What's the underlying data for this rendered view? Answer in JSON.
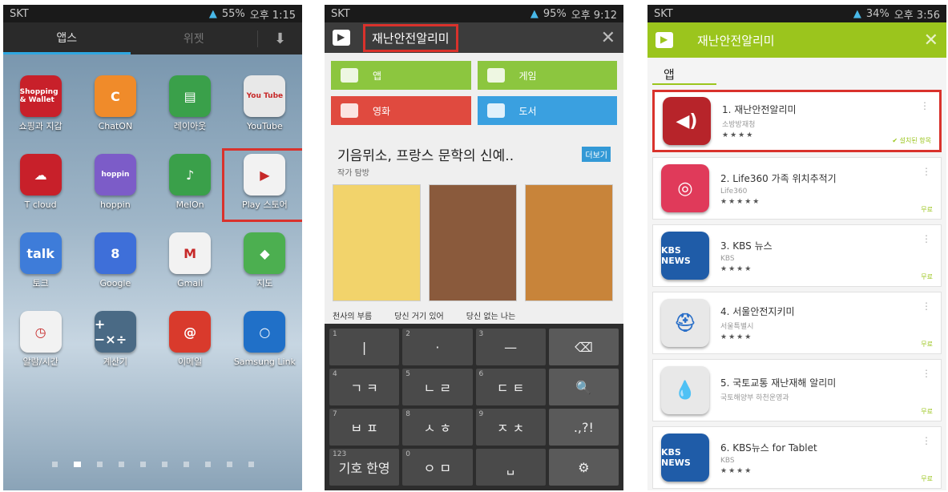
{
  "phone1": {
    "status": {
      "carrier": "SKT",
      "battery": "55%",
      "time": "오후 1:15"
    },
    "tabs": {
      "apps": "앱스",
      "widgets": "위젯",
      "download": "⬇"
    },
    "apps": [
      {
        "label": "쇼핑과 지갑",
        "icon_text": "Shopping & Wallet",
        "color": "#c8202a"
      },
      {
        "label": "ChatON",
        "icon_text": "C",
        "color": "#f08b2a"
      },
      {
        "label": "레이아웃",
        "icon_text": "▤",
        "color": "#3aa04a"
      },
      {
        "label": "YouTube",
        "icon_text": "You Tube",
        "color": "#e8e8e8"
      },
      {
        "label": "T cloud",
        "icon_text": "☁",
        "color": "#c8202a"
      },
      {
        "label": "hoppin",
        "icon_text": "hoppin",
        "color": "#7c5cc8"
      },
      {
        "label": "MelOn",
        "icon_text": "♪",
        "color": "#3aa04a"
      },
      {
        "label": "Play 스토어",
        "icon_text": "▶",
        "color": "#f2f2f2"
      },
      {
        "label": "토크",
        "icon_text": "talk",
        "color": "#3e7cd9"
      },
      {
        "label": "Google",
        "icon_text": "8",
        "color": "#3e6fd9"
      },
      {
        "label": "Gmail",
        "icon_text": "M",
        "color": "#f2f2f2"
      },
      {
        "label": "지도",
        "icon_text": "◆",
        "color": "#4caf50"
      },
      {
        "label": "알람/시간",
        "icon_text": "◷",
        "color": "#f2f2f2"
      },
      {
        "label": "계산기",
        "icon_text": "+−×÷",
        "color": "#4a6a85"
      },
      {
        "label": "이메일",
        "icon_text": "@",
        "color": "#d93a2c"
      },
      {
        "label": "Samsung Link",
        "icon_text": "○",
        "color": "#2070c8"
      }
    ]
  },
  "phone2": {
    "status": {
      "carrier": "SKT",
      "battery": "95%",
      "time": "오후 9:12"
    },
    "search": {
      "query": "재난안전알리미",
      "close": "✕"
    },
    "categories": [
      {
        "label": "앱",
        "color": "#8cc63f"
      },
      {
        "label": "게임",
        "color": "#8cc63f"
      },
      {
        "label": "영화",
        "color": "#e04a3f"
      },
      {
        "label": "도서",
        "color": "#3aa0e0"
      }
    ],
    "section": {
      "title": "기음뮈소, 프랑스 문학의 신예..",
      "subtitle": "작가 탐방",
      "more": "더보기"
    },
    "books": [
      {
        "title": "천사의 부름",
        "color": "#f2d36b"
      },
      {
        "title": "당신 거기 있어",
        "color": "#8a5a3c"
      },
      {
        "title": "당신 없는 나는",
        "color": "#c8843a"
      }
    ],
    "keyboard": [
      {
        "num": "1",
        "chars": "|"
      },
      {
        "num": "2",
        "chars": "·"
      },
      {
        "num": "3",
        "chars": "—"
      },
      {
        "num": "",
        "chars": "⌫"
      },
      {
        "num": "4",
        "chars": "ㄱ ㅋ"
      },
      {
        "num": "5",
        "chars": "ㄴ ㄹ"
      },
      {
        "num": "6",
        "chars": "ㄷ ㅌ"
      },
      {
        "num": "",
        "chars": "🔍"
      },
      {
        "num": "7",
        "chars": "ㅂ ㅍ"
      },
      {
        "num": "8",
        "chars": "ㅅ ㅎ"
      },
      {
        "num": "9",
        "chars": "ㅈ ㅊ"
      },
      {
        "num": "",
        "chars": ".,?!"
      },
      {
        "num": "123",
        "chars": "기호 한영"
      },
      {
        "num": "0",
        "chars": "ㅇ ㅁ"
      },
      {
        "num": "",
        "chars": "␣"
      },
      {
        "num": "",
        "chars": "⚙"
      }
    ]
  },
  "phone3": {
    "status": {
      "carrier": "SKT",
      "battery": "34%",
      "time": "오후 3:56"
    },
    "search": {
      "query": "재난안전알리미",
      "close": "✕"
    },
    "section": "앱",
    "results": [
      {
        "name": "1. 재난안전알리미",
        "dev": "소방방재청",
        "stars": "★★★★",
        "icon_text": "◀)",
        "color": "#b7242a",
        "badge": "✔ 설치된 항목"
      },
      {
        "name": "2. Life360 가족 위치추적기",
        "dev": "Life360",
        "stars": "★★★★★",
        "icon_text": "◎",
        "color": "#e03a5a",
        "badge": "무료"
      },
      {
        "name": "3. KBS 뉴스",
        "dev": "KBS",
        "stars": "★★★★",
        "icon_text": "KBS NEWS",
        "color": "#1f5ca8",
        "badge": "무료"
      },
      {
        "name": "4. 서울안전지키미",
        "dev": "서울특별시",
        "stars": "★★★★",
        "icon_text": "⛑",
        "color": "#e8e8e8",
        "badge": "무료"
      },
      {
        "name": "5. 국토교통 재난재해 알리미",
        "dev": "국토해양부 하천운영과",
        "stars": "",
        "icon_text": "💧",
        "color": "#e8e8e8",
        "badge": "무료"
      },
      {
        "name": "6. KBS뉴스 for Tablet",
        "dev": "KBS",
        "stars": "★★★★",
        "icon_text": "KBS NEWS",
        "color": "#1f5ca8",
        "badge": "무료"
      }
    ]
  }
}
